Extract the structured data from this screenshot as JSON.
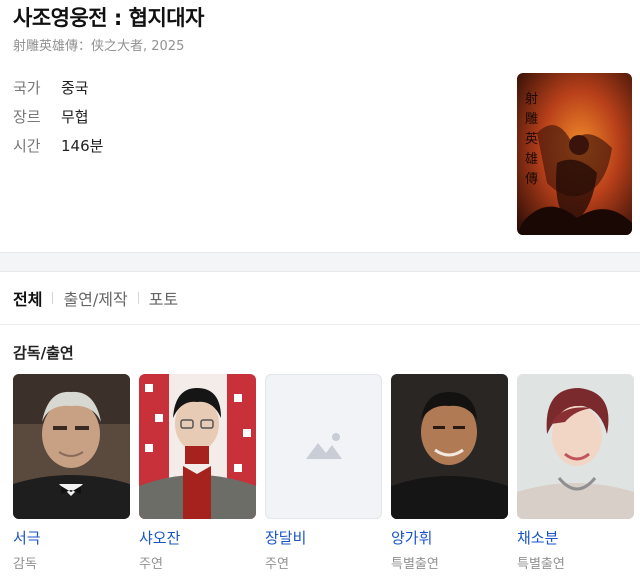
{
  "movie": {
    "title": "사조영웅전 : 협지대자",
    "subtitle": "射雕英雄傳：侠之大者, 2025",
    "info": [
      {
        "label": "국가",
        "value": "중국"
      },
      {
        "label": "장르",
        "value": "무협"
      },
      {
        "label": "시간",
        "value": "146분"
      }
    ],
    "poster_icon": "movie-poster"
  },
  "tabs": [
    {
      "label": "전체",
      "active": true
    },
    {
      "label": "출연/제작",
      "active": false
    },
    {
      "label": "포토",
      "active": false
    }
  ],
  "cast_section": {
    "title": "감독/출연",
    "people": [
      {
        "name": "서극",
        "role": "감독",
        "photo": "portrait-director"
      },
      {
        "name": "샤오잔",
        "role": "주연",
        "photo": "portrait-actor"
      },
      {
        "name": "장달비",
        "role": "주연",
        "photo": "image-placeholder-icon"
      },
      {
        "name": "양가휘",
        "role": "특별출연",
        "photo": "portrait-actor"
      },
      {
        "name": "채소분",
        "role": "특별출연",
        "photo": "portrait-actress"
      }
    ]
  },
  "colors": {
    "link": "#1a55c7",
    "muted": "#929292",
    "band": "#f4f5f7"
  }
}
